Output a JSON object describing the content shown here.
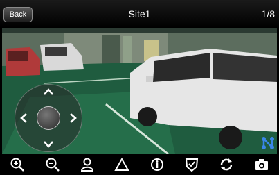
{
  "header": {
    "back_label": "Back",
    "title": "Site1",
    "page_indicator": "1/8"
  },
  "video": {
    "icon": "camera-live-feed"
  },
  "ptz": {
    "icons": [
      "ptz-up-icon",
      "ptz-down-icon",
      "ptz-left-icon",
      "ptz-right-icon",
      "ptz-joystick-knob"
    ]
  },
  "overlay": {
    "layout_icon": "layout-switch-icon",
    "accent": "#3a86e8"
  },
  "toolbar": {
    "icons": [
      "zoom-in-icon",
      "zoom-out-icon",
      "person-icon",
      "warning-icon",
      "info-icon",
      "shield-check-icon",
      "refresh-icon",
      "snapshot-icon"
    ]
  }
}
